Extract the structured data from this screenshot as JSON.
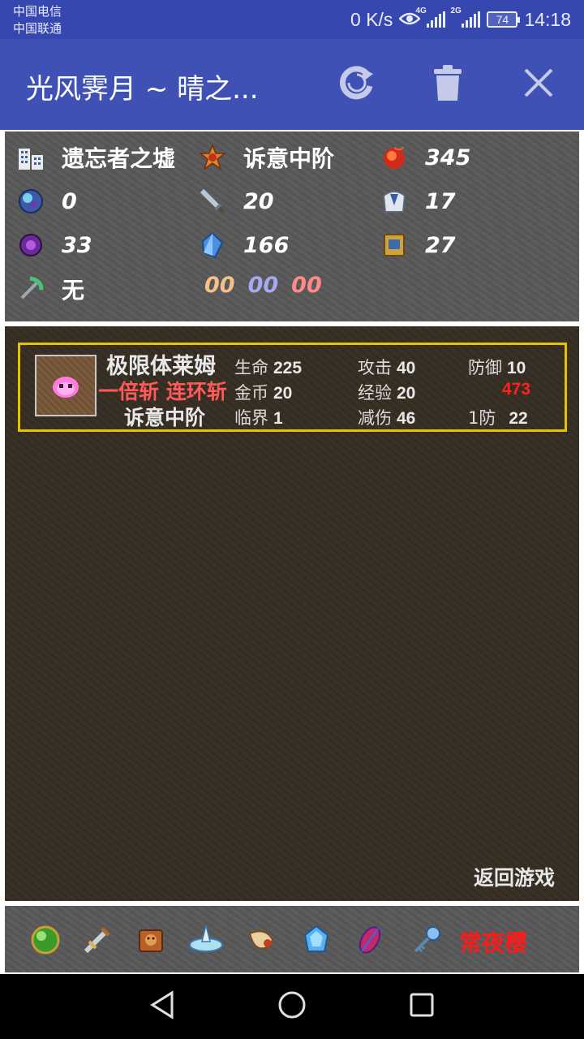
{
  "status_bar": {
    "carrier_1": "中国电信",
    "carrier_2": "中国联通",
    "net_speed": "0 K/s",
    "signal_1": "4G",
    "signal_2": "2G",
    "battery": "74",
    "time": "14:18"
  },
  "app_bar": {
    "title": "光风霁月 ~ 晴之...",
    "icons": [
      "refresh-icon",
      "trash-icon",
      "close-icon"
    ]
  },
  "stats": {
    "floor": "遗忘者之墟",
    "rank": "诉意中阶",
    "hp": "345",
    "magic_orb": "0",
    "attack": "20",
    "defense": "17",
    "magic_defense": "33",
    "crystal": "166",
    "gold": "27",
    "equipment": "无",
    "keys": [
      {
        "value": "00",
        "color": "#f5c08a"
      },
      {
        "value": "00",
        "color": "#a8a8f0"
      },
      {
        "value": "00",
        "color": "#ff8a8a"
      }
    ]
  },
  "monster": {
    "name": "极限体莱姆",
    "special": "一倍斩 连环斩",
    "rank": "诉意中阶",
    "hp_label": "生命",
    "hp": "225",
    "atk_label": "攻击",
    "atk": "40",
    "def_label": "防御",
    "def": "10",
    "gold_label": "金币",
    "gold": "20",
    "exp_label": "经验",
    "exp": "20",
    "damage": "473",
    "critical_label": "临界",
    "critical": "1",
    "reduction_label": "减伤",
    "reduction": "46",
    "def1_label": "1防",
    "def1": "22"
  },
  "return_label": "返回游戏",
  "toolbar": {
    "items": [
      "green-orb-icon",
      "sword-icon",
      "monster-book-icon",
      "fly-icon",
      "horn-icon",
      "ice-crystal-icon",
      "feather-icon",
      "key-wand-icon"
    ],
    "label": "常夜樱"
  },
  "colors": {
    "status_bar": "#3747b0",
    "app_bar": "#3f51b5",
    "card_border": "#e6c200",
    "damage": "#ff2020",
    "special": "#ff5a5a"
  }
}
